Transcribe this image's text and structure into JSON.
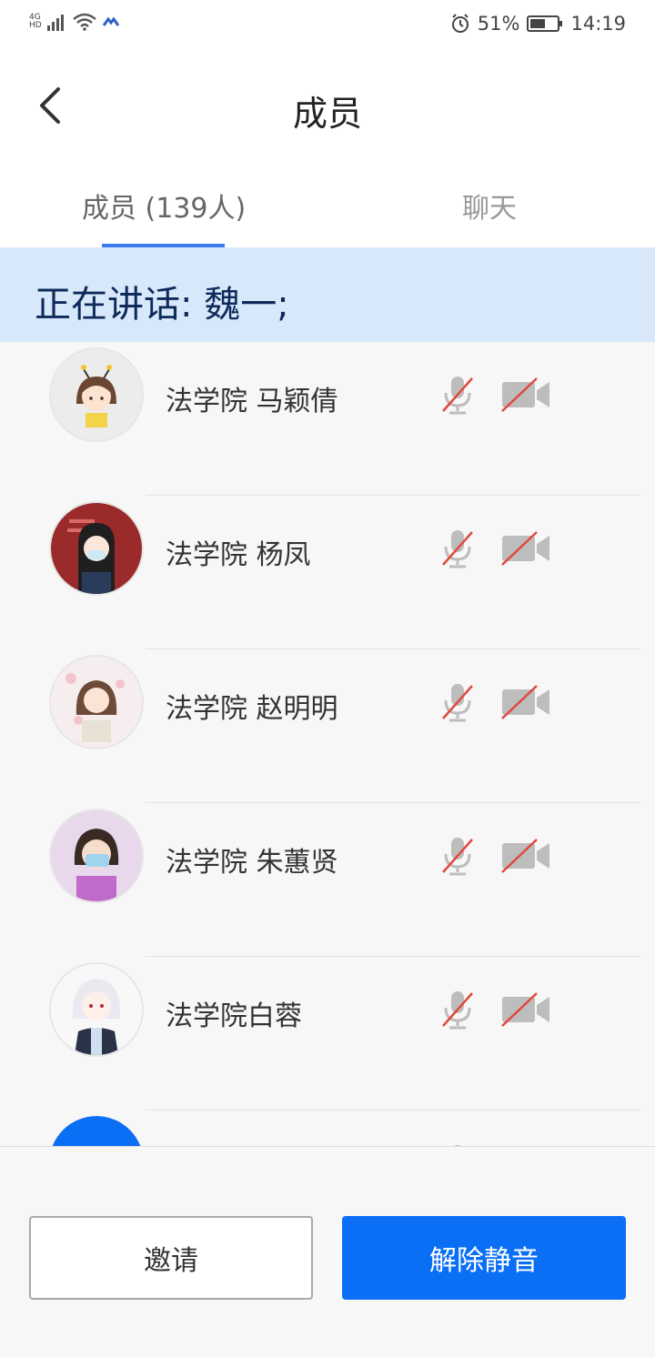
{
  "status_bar": {
    "network_type": "4G",
    "network_sub": "HD",
    "battery": "51%",
    "time": "14:19",
    "icons": [
      "signal-icon",
      "wifi-icon",
      "app-notification-icon",
      "alarm-icon",
      "battery-icon"
    ]
  },
  "header": {
    "title": "成员",
    "back_icon": "chevron-left-icon"
  },
  "tabs": [
    {
      "label": "成员 (139人)",
      "active": true
    },
    {
      "label": "聊天",
      "active": false
    }
  ],
  "speaking_banner": {
    "text": "正在讲话: 魏一;"
  },
  "members": [
    {
      "name": "法学院 马颖倩",
      "mic_muted": true,
      "video_off": true,
      "avatar": "avatar-cartoon-girl-bee"
    },
    {
      "name": "法学院 杨凤",
      "mic_muted": true,
      "video_off": true,
      "avatar": "avatar-girl-mask-red"
    },
    {
      "name": "法学院 赵明明",
      "mic_muted": true,
      "video_off": true,
      "avatar": "avatar-girl-flowers"
    },
    {
      "name": "法学院 朱蕙贤",
      "mic_muted": true,
      "video_off": true,
      "avatar": "avatar-child-mask"
    },
    {
      "name": "法学院白蓉",
      "mic_muted": true,
      "video_off": true,
      "avatar": "avatar-anime-white-hair"
    },
    {
      "name": "",
      "mic_muted": true,
      "video_off": true,
      "avatar": "avatar-blue-circle"
    }
  ],
  "footer": {
    "invite_label": "邀请",
    "unmute_label": "解除静音"
  },
  "colors": {
    "accent": "#0b6ff6",
    "tab_underline": "#3a7cf0",
    "banner_bg": "#d8e8fb",
    "muted_red": "#e0493c"
  }
}
